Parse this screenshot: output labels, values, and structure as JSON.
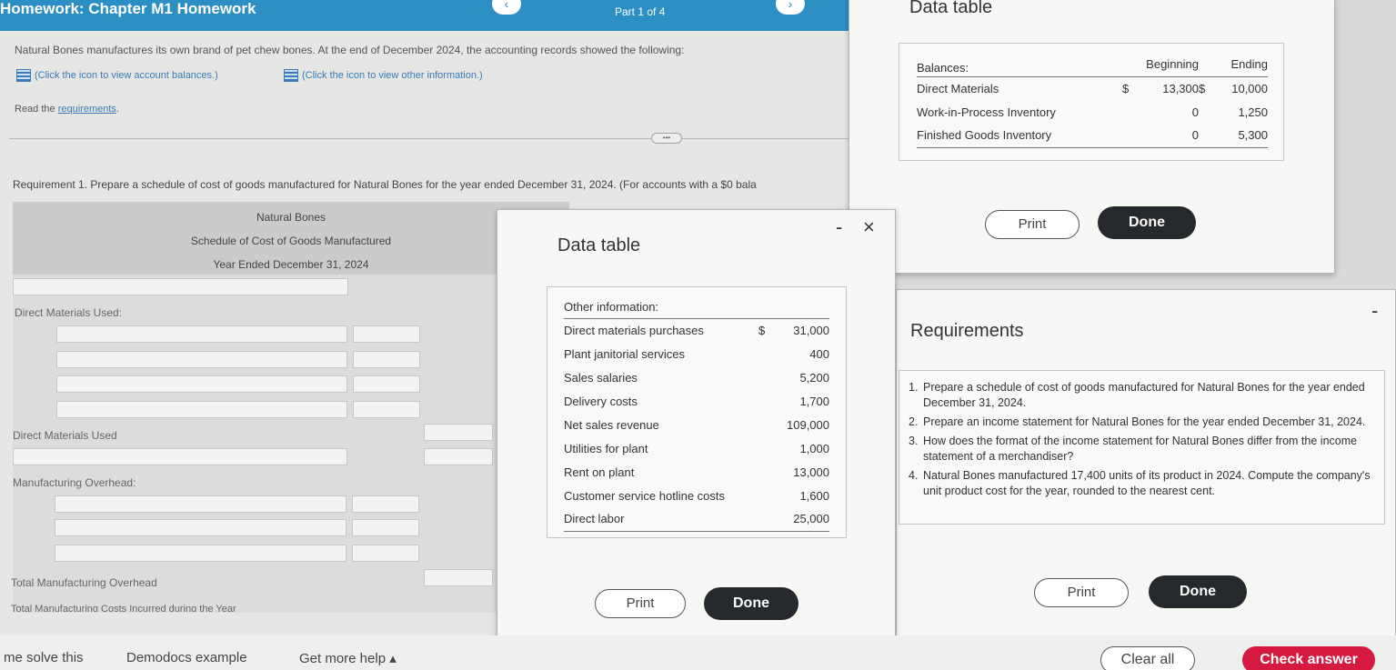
{
  "header": {
    "title": "Homework: Chapter M1 Homework",
    "part": "Part 1 of 4",
    "prev_icon": "chevron-left-icon",
    "next_icon": "chevron-right-icon"
  },
  "main": {
    "intro": "Natural Bones manufactures its own brand of pet chew bones. At the end of December 2024, the accounting records showed the following:",
    "link_balances": "(Click the icon to view account balances.)",
    "link_other": "(Click the icon to view other information.)",
    "read_prefix": "Read the ",
    "read_link": "requirements",
    "read_suffix": ".",
    "requirement1": "Requirement 1. Prepare a schedule of cost of goods manufactured for Natural Bones for the year ended December 31, 2024. (For accounts with a $0 bala",
    "schedule": {
      "company": "Natural Bones",
      "title": "Schedule of Cost of Goods Manufactured",
      "period": "Year Ended December 31, 2024",
      "label_dm_used_heading": "Direct Materials Used:",
      "label_dm_used_total": "Direct Materials Used",
      "label_mo_heading": "Manufacturing Overhead:",
      "label_mo_total": "Total Manufacturing Overhead",
      "label_total_costs": "Total Manufacturing Costs Incurred during the Year"
    }
  },
  "data_table_balances": {
    "title": "Data table",
    "header": [
      "Balances:",
      "Beginning",
      "Ending"
    ],
    "rows": [
      {
        "label": "Direct Materials",
        "begin_sym": "$",
        "begin": "13,300",
        "end_sym": "$",
        "end": "10,000"
      },
      {
        "label": "Work-in-Process Inventory",
        "begin_sym": "",
        "begin": "0",
        "end_sym": "",
        "end": "1,250"
      },
      {
        "label": "Finished Goods Inventory",
        "begin_sym": "",
        "begin": "0",
        "end_sym": "",
        "end": "5,300"
      }
    ],
    "print": "Print",
    "done": "Done"
  },
  "data_table_other": {
    "title": "Data table",
    "header": "Other information:",
    "rows": [
      {
        "label": "Direct materials purchases",
        "sym": "$",
        "value": "31,000"
      },
      {
        "label": "Plant janitorial services",
        "sym": "",
        "value": "400"
      },
      {
        "label": "Sales salaries",
        "sym": "",
        "value": "5,200"
      },
      {
        "label": "Delivery costs",
        "sym": "",
        "value": "1,700"
      },
      {
        "label": "Net sales revenue",
        "sym": "",
        "value": "109,000"
      },
      {
        "label": "Utilities for plant",
        "sym": "",
        "value": "1,000"
      },
      {
        "label": "Rent on plant",
        "sym": "",
        "value": "13,000"
      },
      {
        "label": "Customer service hotline costs",
        "sym": "",
        "value": "1,600"
      },
      {
        "label": "Direct labor",
        "sym": "",
        "value": "25,000"
      }
    ],
    "minimize": "-",
    "close": "×",
    "print": "Print",
    "done": "Done"
  },
  "requirements": {
    "title": "Requirements",
    "items": [
      {
        "n": "1.",
        "text": "Prepare a schedule of cost of goods manufactured for Natural Bones for the year ended December 31, 2024."
      },
      {
        "n": "2.",
        "text": "Prepare an income statement for Natural Bones for the year ended December 31, 2024."
      },
      {
        "n": "3.",
        "text": "How does the format of the income statement for Natural Bones differ from the income statement of a merchandiser?"
      },
      {
        "n": "4.",
        "text": "Natural Bones manufactured 17,400 units of its product in 2024. Compute the company's unit product cost for the year, rounded to the nearest cent."
      }
    ],
    "minimize": "-",
    "print": "Print",
    "done": "Done"
  },
  "footer": {
    "help_solve": "me solve this",
    "demodocs": "Demodocs example",
    "more_help": "Get more help ▴",
    "clear_all": "Clear all",
    "check_answer": "Check answer"
  }
}
